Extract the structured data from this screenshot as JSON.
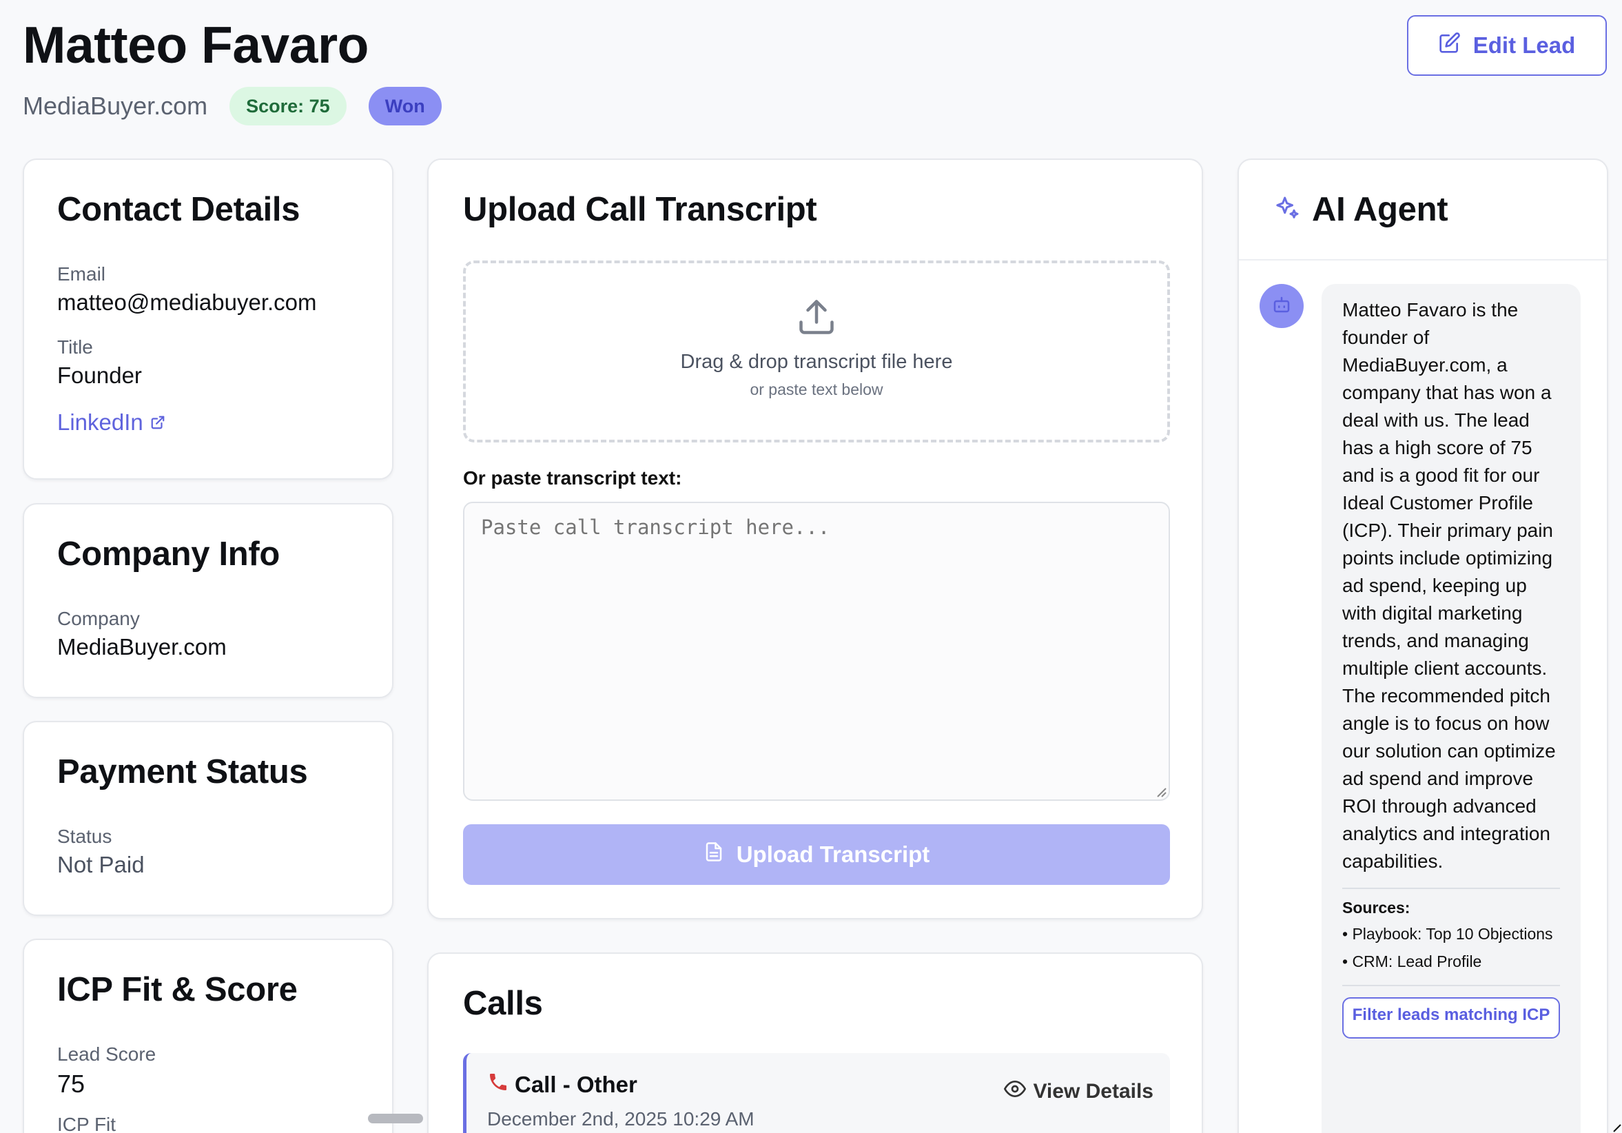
{
  "header": {
    "lead_name": "Matteo Favaro",
    "company": "MediaBuyer.com",
    "score_badge": "Score: 75",
    "status_badge": "Won",
    "edit_button": "Edit Lead"
  },
  "contact": {
    "title": "Contact Details",
    "email_label": "Email",
    "email_value": "matteo@mediabuyer.com",
    "title_label": "Title",
    "title_value": "Founder",
    "linkedin_label": "LinkedIn"
  },
  "company_info": {
    "title": "Company Info",
    "company_label": "Company",
    "company_value": "MediaBuyer.com"
  },
  "payment": {
    "title": "Payment Status",
    "status_label": "Status",
    "status_value": "Not Paid"
  },
  "icp": {
    "title": "ICP Fit & Score",
    "score_label": "Lead Score",
    "score_value": "75",
    "fit_label": "ICP Fit"
  },
  "upload": {
    "title": "Upload Call Transcript",
    "dropzone_main": "Drag & drop transcript file here",
    "dropzone_sub": "or paste text below",
    "paste_label": "Or paste transcript text:",
    "textarea_placeholder": "Paste call transcript here...",
    "upload_button": "Upload Transcript"
  },
  "calls": {
    "title": "Calls",
    "items": [
      {
        "title": "Call - Other",
        "date": "December 2nd, 2025 10:29 AM",
        "view_label": "View Details"
      }
    ]
  },
  "ai_agent": {
    "title": "AI Agent",
    "message": "Matteo Favaro is the founder of MediaBuyer.com, a company that has won a deal with us. The lead has a high score of 75 and is a good fit for our Ideal Customer Profile (ICP). Their primary pain points include optimizing ad spend, keeping up with digital marketing trends, and managing multiple client accounts. The recommended pitch angle is to focus on how our solution can optimize ad spend and improve ROI through advanced analytics and integration capabilities.",
    "sources_label": "Sources:",
    "sources": [
      "• Playbook: Top 10 Objections",
      "• CRM: Lead Profile"
    ],
    "action_button": "Filter leads matching ICP"
  },
  "colors": {
    "accent": "#6a6fe3",
    "score_badge_bg": "#dcf7e3",
    "won_badge_bg": "#8b8ff3",
    "upload_button_bg": "#b0b4f6"
  },
  "icons": [
    "edit-icon",
    "external-link-icon",
    "upload-icon",
    "file-icon",
    "sparkles-icon",
    "bot-icon",
    "phone-icon",
    "eye-icon"
  ]
}
